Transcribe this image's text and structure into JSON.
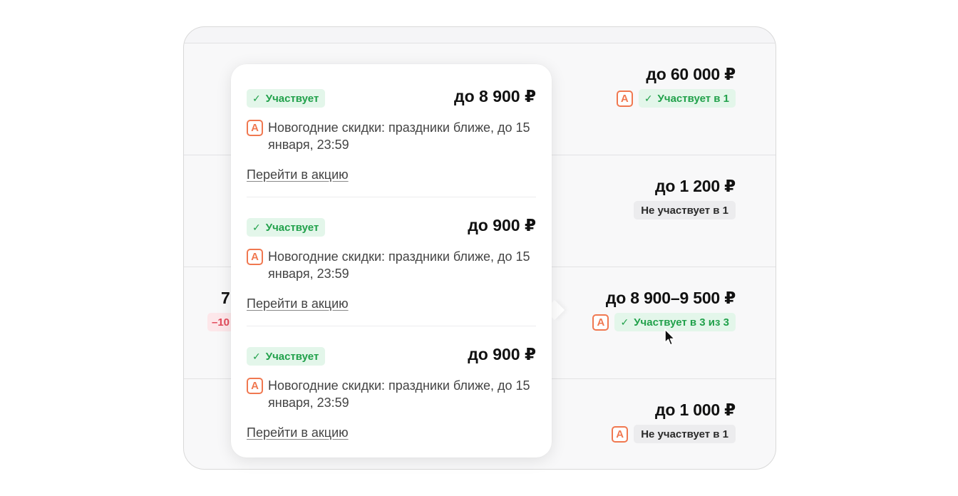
{
  "rows": [
    {
      "price": "до 60 000 ₽",
      "has_a_icon": true,
      "status_style": "green",
      "status": "Участвует в 1"
    },
    {
      "price": "до 1 200 ₽",
      "has_a_icon": false,
      "status_style": "gray",
      "status": "Не участвует в 1"
    },
    {
      "price": "до 8 900–9 500 ₽",
      "has_a_icon": true,
      "status_style": "green",
      "status": "Участвует в 3 из 3",
      "left_value": "7",
      "left_discount": "–10"
    },
    {
      "price": "до 1 000 ₽",
      "has_a_icon": true,
      "status_style": "gray",
      "status": "Не участвует в 1"
    }
  ],
  "popover": {
    "promos": [
      {
        "status": "Участвует",
        "price": "до 8 900 ₽",
        "description": "Новогодние скидки: праздники ближе, до 15 января, 23:59",
        "link": "Перейти в акцию"
      },
      {
        "status": "Участвует",
        "price": "до 900 ₽",
        "description": "Новогодние скидки: праздники ближе, до 15 января, 23:59",
        "link": "Перейти в акцию"
      },
      {
        "status": "Участвует",
        "price": "до 900 ₽",
        "description": "Новогодние скидки: праздники ближе, до 15 января, 23:59",
        "link": "Перейти в акцию"
      }
    ]
  },
  "icons": {
    "promo": "А",
    "check": "✓"
  },
  "colors": {
    "accent_orange": "#f07850",
    "success_green": "#21a14b",
    "success_bg": "#e3f6ea",
    "neutral_bg": "#ececee",
    "discount_red": "#e24a5a"
  }
}
